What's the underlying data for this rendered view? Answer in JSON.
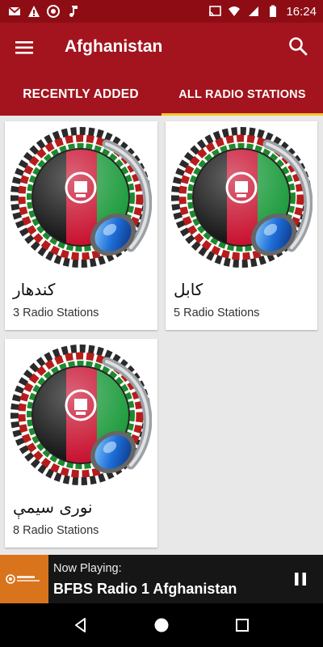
{
  "status_bar": {
    "time": "16:24",
    "left_icons": [
      "gmail-icon",
      "warning-icon",
      "aperture-icon",
      "music-note-icon"
    ],
    "right_icons": [
      "cast-icon",
      "wifi-icon",
      "signal-icon",
      "battery-icon"
    ]
  },
  "app_bar": {
    "title": "Afghanistan",
    "menu_icon": "hamburger-menu-icon",
    "search_icon": "search-icon"
  },
  "tabs": [
    {
      "label": "RECENTLY ADDED",
      "selected": false
    },
    {
      "label": "ALL RADIO STATIONS",
      "selected": true
    }
  ],
  "cards": [
    {
      "name": "کندهار",
      "count": "3 Radio Stations"
    },
    {
      "name": "کابل",
      "count": "5 Radio Stations"
    },
    {
      "name": "نوری سیمې",
      "count": "8 Radio Stations"
    }
  ],
  "now_playing": {
    "label": "Now Playing:",
    "station": "BFBS Radio 1 Afghanistan",
    "control_icon": "pause-icon"
  },
  "nav_bar": {
    "buttons": [
      "back-icon",
      "home-icon",
      "recents-icon"
    ]
  },
  "colors": {
    "status_bar": "#8e0d15",
    "app_bar": "#a3141e",
    "tab_indicator": "#f7c52b",
    "now_playing_thumb": "#d9741d"
  }
}
